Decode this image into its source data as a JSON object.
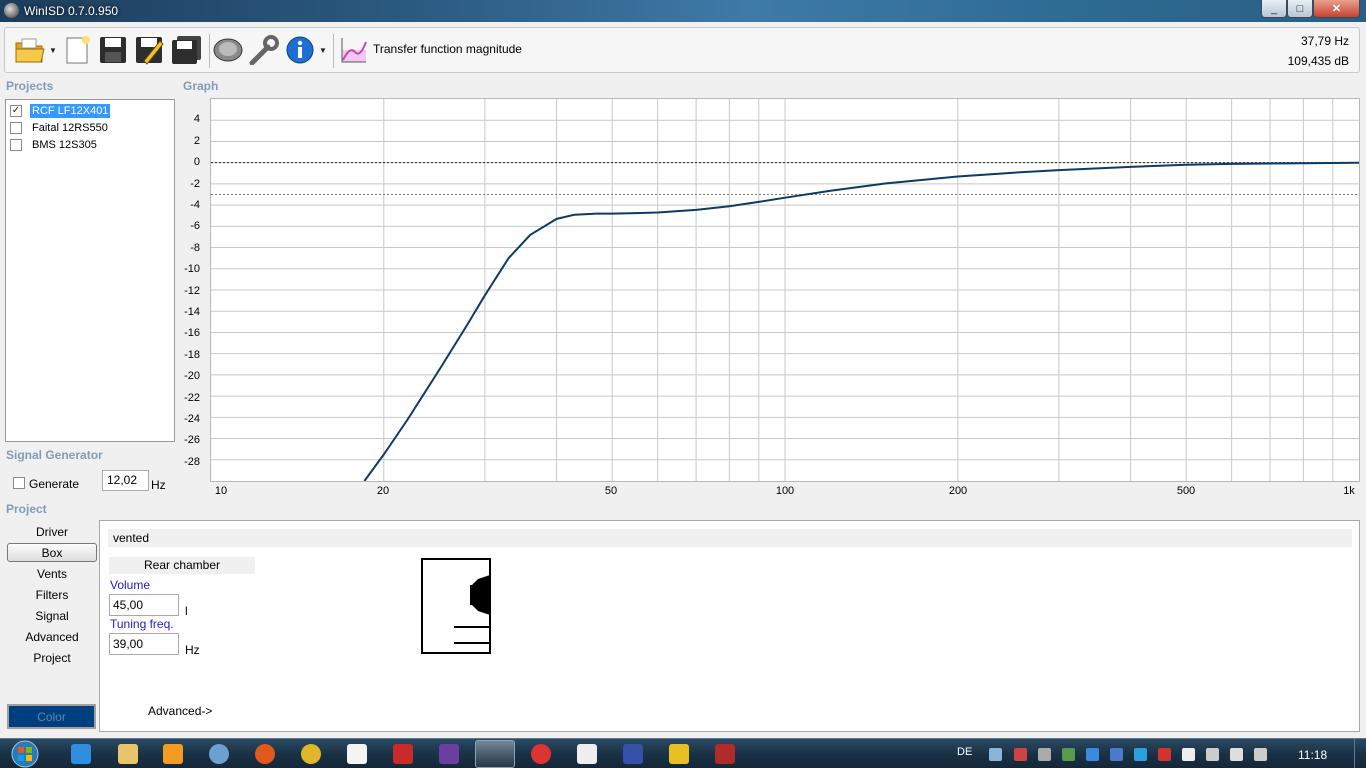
{
  "window": {
    "title": "WinISD 0.7.0.950",
    "minimize_glyph": "_",
    "maximize_glyph": "□",
    "close_glyph": "✕"
  },
  "toolbar": {
    "view_label": "Transfer function magnitude",
    "readout_freq": "37,79 Hz",
    "readout_db": "109,435 dB",
    "icons": [
      "open-folder-icon",
      "new-document-icon",
      "save-icon",
      "save-as-icon",
      "save-all-icon",
      "driver-icon",
      "tools-icon",
      "info-icon",
      "graph-type-icon"
    ]
  },
  "sections": {
    "projects": "Projects",
    "graph": "Graph",
    "signal_generator": "Signal Generator",
    "project": "Project"
  },
  "projects": [
    {
      "label": "RCF LF12X401",
      "checked": true,
      "selected": true
    },
    {
      "label": "Faital 12RS550",
      "checked": false,
      "selected": false
    },
    {
      "label": "BMS 12S305",
      "checked": false,
      "selected": false
    }
  ],
  "signal_generator": {
    "generate_label": "Generate",
    "frequency_value": "12,02",
    "unit": "Hz"
  },
  "graph": {
    "y_ticks": [
      "4",
      "2",
      "0",
      "-2",
      "-4",
      "-6",
      "-8",
      "-10",
      "-12",
      "-14",
      "-16",
      "-18",
      "-20",
      "-22",
      "-24",
      "-26",
      "-28"
    ],
    "x_tick_labels": [
      "10",
      "20",
      "50",
      "100",
      "200",
      "500",
      "1k"
    ]
  },
  "chart_data": {
    "type": "line",
    "x_scale": "log",
    "xlim": [
      10,
      1000
    ],
    "ylim": [
      -30,
      6
    ],
    "grid": true,
    "reference_lines": [
      0,
      -3
    ],
    "series": [
      {
        "color": "#0b3b66",
        "x": [
          18.5,
          20,
          22,
          25,
          28,
          30,
          33,
          36,
          40,
          43,
          47,
          50,
          55,
          60,
          70,
          80,
          90,
          100,
          120,
          150,
          200,
          250,
          300,
          400,
          500,
          600,
          800,
          1000
        ],
        "y": [
          -30,
          -27.5,
          -24.2,
          -19.5,
          -15.2,
          -12.5,
          -9,
          -6.8,
          -5.3,
          -4.9,
          -4.8,
          -4.8,
          -4.75,
          -4.7,
          -4.45,
          -4.1,
          -3.7,
          -3.3,
          -2.65,
          -1.95,
          -1.3,
          -0.95,
          -0.7,
          -0.4,
          -0.2,
          -0.12,
          -0.05,
          0
        ]
      }
    ]
  },
  "project_tabs": [
    {
      "label": "Driver",
      "active": false
    },
    {
      "label": "Box",
      "active": true
    },
    {
      "label": "Vents",
      "active": false
    },
    {
      "label": "Filters",
      "active": false
    },
    {
      "label": "Signal",
      "active": false
    },
    {
      "label": "Advanced",
      "active": false
    },
    {
      "label": "Project",
      "active": false
    }
  ],
  "color_button": {
    "label": "Color",
    "swatch": "#003f7f"
  },
  "box": {
    "type": "vented",
    "rear_chamber_label": "Rear chamber",
    "volume_label": "Volume",
    "volume_value": "45,00",
    "volume_unit": "l",
    "tuning_label": "Tuning freq.",
    "tuning_value": "39,00",
    "tuning_unit": "Hz",
    "advanced_link": "Advanced->"
  },
  "taskbar": {
    "language": "DE",
    "clock": "11:18"
  }
}
